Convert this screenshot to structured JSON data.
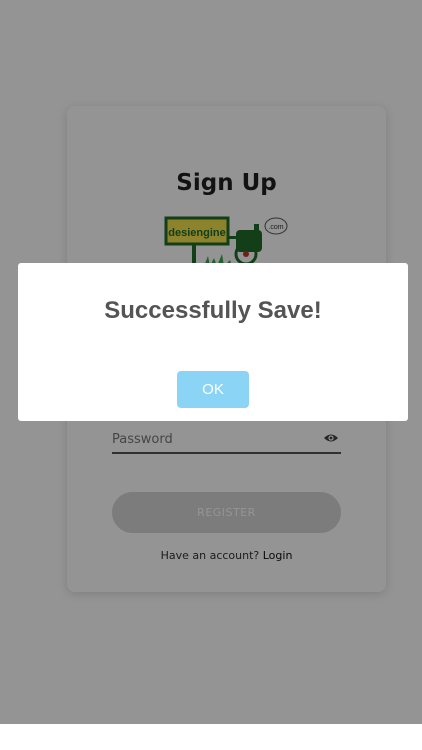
{
  "signup": {
    "title": "Sign Up",
    "logo_text": "desiengine",
    "logo_badge": ".com",
    "password_placeholder": "Password",
    "register_label": "REGISTER",
    "account_prompt": "Have an account?",
    "login_label": "Login"
  },
  "dialog": {
    "message": "Successfully Save!",
    "ok_label": "OK"
  },
  "colors": {
    "overlay": "#000000",
    "dialog_button": "#8cd4f5",
    "register_button": "#d6d6d6"
  }
}
